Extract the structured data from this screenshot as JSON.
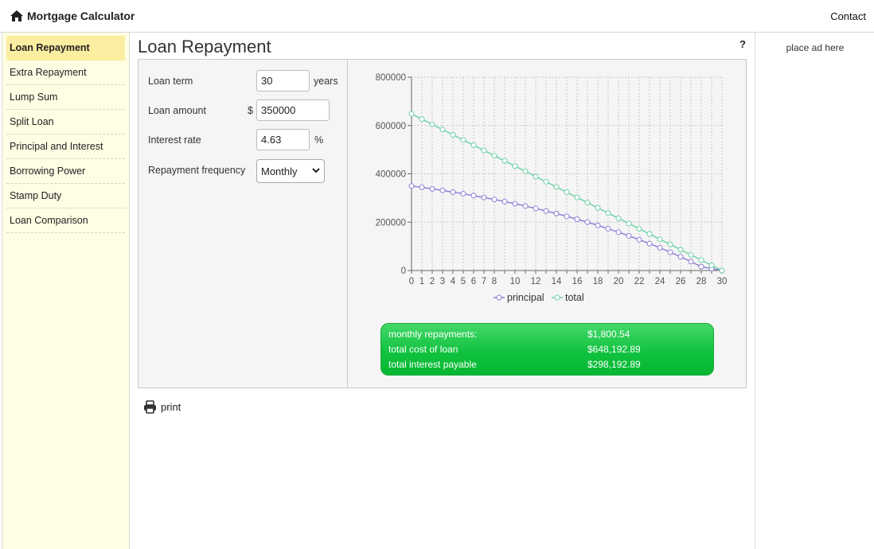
{
  "header": {
    "brand": "Mortgage Calculator",
    "contact": "Contact"
  },
  "sidebar": {
    "items": [
      {
        "label": "Loan Repayment",
        "active": true
      },
      {
        "label": "Extra Repayment"
      },
      {
        "label": "Lump Sum"
      },
      {
        "label": "Split Loan"
      },
      {
        "label": "Principal and Interest"
      },
      {
        "label": "Borrowing Power"
      },
      {
        "label": "Stamp Duty"
      },
      {
        "label": "Loan Comparison"
      }
    ]
  },
  "main": {
    "title": "Loan Repayment",
    "help": "?",
    "form": {
      "loan_term": {
        "label": "Loan term",
        "value": "30",
        "unit": "years"
      },
      "loan_amount": {
        "label": "Loan amount",
        "prefix": "$",
        "value": "350000"
      },
      "interest_rate": {
        "label": "Interest rate",
        "value": "4.63",
        "unit": "%"
      },
      "frequency": {
        "label": "Repayment frequency",
        "selected": "Monthly"
      }
    },
    "summary": {
      "rows": [
        {
          "label": "monthly repayments:",
          "value": "$1,800.54"
        },
        {
          "label": "total cost of loan",
          "value": "$648,192.89"
        },
        {
          "label": "total interest payable",
          "value": "$298,192.89"
        }
      ]
    },
    "print": "print"
  },
  "ad": {
    "text": "place ad here"
  },
  "chart_data": {
    "type": "line",
    "x": [
      0,
      1,
      2,
      3,
      4,
      5,
      6,
      7,
      8,
      9,
      10,
      11,
      12,
      13,
      14,
      15,
      16,
      17,
      18,
      19,
      20,
      21,
      22,
      23,
      24,
      25,
      26,
      27,
      28,
      29,
      30
    ],
    "x_tick_labels": [
      "0",
      "1",
      "2",
      "3",
      "4",
      "5",
      "6",
      "7",
      "8",
      "10",
      "12",
      "14",
      "16",
      "18",
      "20",
      "22",
      "24",
      "26",
      "28",
      "30"
    ],
    "y_ticks": [
      0,
      200000,
      400000,
      600000,
      800000
    ],
    "ylim": [
      0,
      800000
    ],
    "xlim": [
      0,
      30
    ],
    "grid": true,
    "legend_position": "bottom",
    "series": [
      {
        "name": "principal",
        "color": "#8f7fd6",
        "values": [
          350000,
          344100,
          337900,
          331400,
          324600,
          317500,
          310000,
          302200,
          294000,
          285400,
          276400,
          266900,
          257000,
          246600,
          235700,
          224300,
          212400,
          199900,
          186800,
          173100,
          158700,
          143600,
          127800,
          111300,
          93900,
          75800,
          56800,
          36900,
          16000,
          8000,
          0
        ]
      },
      {
        "name": "total",
        "color": "#6fd1a6",
        "values": [
          648193,
          626586,
          604979,
          583373,
          561766,
          540160,
          518553,
          496947,
          475340,
          453734,
          432127,
          410521,
          388914,
          367307,
          345701,
          324094,
          302488,
          280881,
          259275,
          237668,
          216062,
          194455,
          172849,
          151242,
          129636,
          108029,
          86422,
          64816,
          43209,
          21603,
          0
        ]
      }
    ]
  },
  "colors": {
    "sidebar_bg": "#fffde3",
    "sidebar_active": "#fbeea0",
    "summary_green": "#11c23f",
    "principal": "#8f7fd6",
    "total": "#6fd1a6"
  }
}
